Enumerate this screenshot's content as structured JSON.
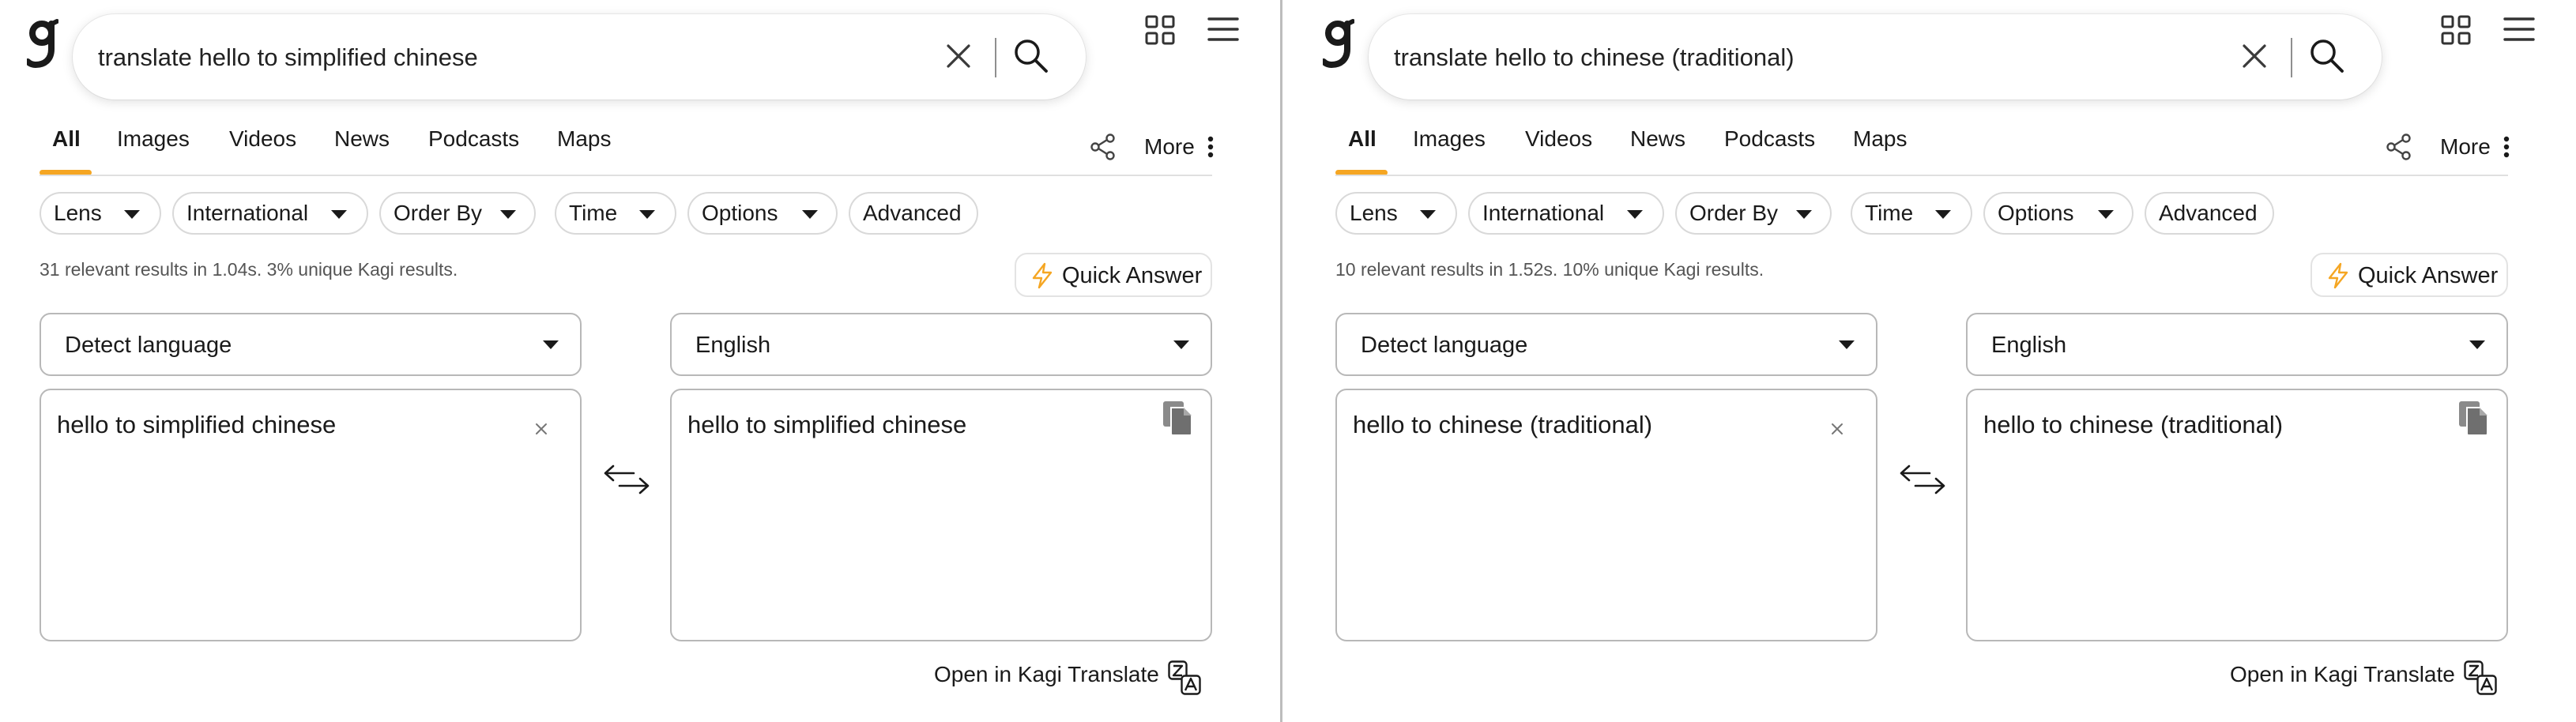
{
  "panes": [
    {
      "search": {
        "query": "translate hello to simplified chinese"
      },
      "tabs": [
        "All",
        "Images",
        "Videos",
        "News",
        "Podcasts",
        "Maps"
      ],
      "more_label": "More",
      "filters": [
        "Lens",
        "International",
        "Order By",
        "Time",
        "Options",
        "Advanced"
      ],
      "stats": "31 relevant results in 1.04s. 3% unique Kagi results.",
      "quick_answer_label": "Quick Answer",
      "translate": {
        "source_lang": "Detect language",
        "target_lang": "English",
        "source_text": "hello to simplified chinese",
        "target_text": "hello to simplified chinese",
        "open_label": "Open in Kagi Translate"
      }
    },
    {
      "search": {
        "query": "translate hello to chinese (traditional)"
      },
      "tabs": [
        "All",
        "Images",
        "Videos",
        "News",
        "Podcasts",
        "Maps"
      ],
      "more_label": "More",
      "filters": [
        "Lens",
        "International",
        "Order By",
        "Time",
        "Options",
        "Advanced"
      ],
      "stats": "10 relevant results in 1.52s. 10% unique Kagi results.",
      "quick_answer_label": "Quick Answer",
      "translate": {
        "source_lang": "Detect language",
        "target_lang": "English",
        "source_text": "hello to chinese (traditional)",
        "target_text": "hello to chinese (traditional)",
        "open_label": "Open in Kagi Translate"
      }
    }
  ],
  "colors": {
    "accent": "#f5a623",
    "text": "#1a1a1a",
    "muted": "#555555",
    "border": "#b8b8b8"
  },
  "icons": [
    "kagi-logo",
    "clear-icon",
    "search-icon",
    "apps-grid-icon",
    "hamburger-menu-icon",
    "share-icon",
    "kebab-menu-icon",
    "caret-down-icon",
    "lightning-icon",
    "swap-icon",
    "copy-icon",
    "translate-icon"
  ]
}
